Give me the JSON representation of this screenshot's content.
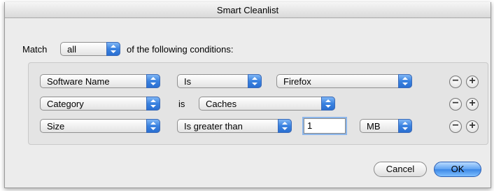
{
  "window": {
    "title": "Smart Cleanlist"
  },
  "match": {
    "prefix": "Match",
    "selector": "all",
    "suffix": "of the following conditions:"
  },
  "conditions": [
    {
      "field": "Software Name",
      "operator": "Is",
      "value": "Firefox"
    },
    {
      "field": "Category",
      "operator": "is",
      "value": "Caches"
    },
    {
      "field": "Size",
      "operator": "Is greater than",
      "value": "1",
      "unit": "MB"
    }
  ],
  "row_buttons": {
    "remove": "−",
    "add": "+"
  },
  "buttons": {
    "cancel": "Cancel",
    "ok": "OK"
  },
  "icons": {
    "popup": "updown-arrows-icon",
    "remove": "minus-icon",
    "add": "plus-icon"
  },
  "colors": {
    "accent": "#3a82e0",
    "background": "#ececec",
    "group_background": "#e4e4e4"
  }
}
